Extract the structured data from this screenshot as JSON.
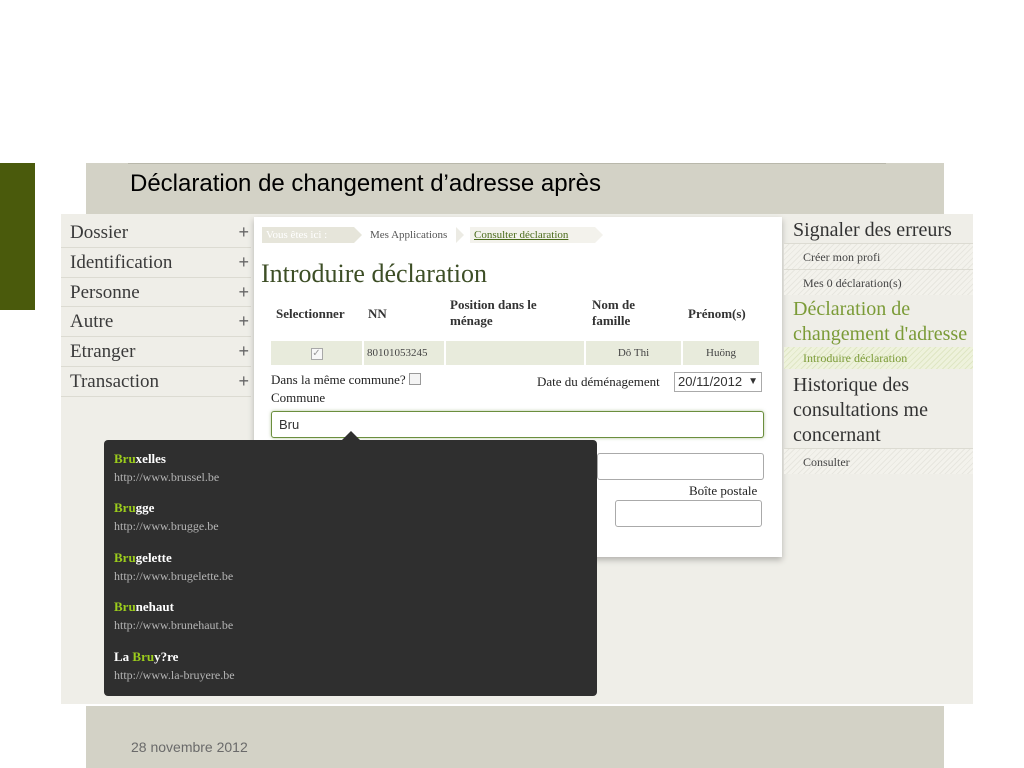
{
  "slide": {
    "title": "Déclaration de changement d’adresse après",
    "footer_date": "28 novembre 2012"
  },
  "left_nav": [
    {
      "label": "Dossier",
      "expander": "+"
    },
    {
      "label": "Identification",
      "expander": "+"
    },
    {
      "label": "Personne",
      "expander": "+"
    },
    {
      "label": "Autre",
      "expander": "+"
    },
    {
      "label": "Etranger",
      "expander": "+"
    },
    {
      "label": "Transaction",
      "expander": "+"
    }
  ],
  "breadcrumb": {
    "here": "Vous êtes ici :",
    "applications": "Mes Applications",
    "current": "Consulter déclaration"
  },
  "page_title": "Introduire déclaration",
  "table": {
    "headers": {
      "select": "Selectionner",
      "nn": "NN",
      "position": "Position dans le ménage",
      "nom": "Nom de famille",
      "prenom": "Prénom(s)"
    },
    "rows": [
      {
        "checked": true,
        "check_glyph": "✓",
        "nn": "80101053245",
        "position": "",
        "nom": "Dô Thi",
        "prenom": "Huöng"
      }
    ]
  },
  "form": {
    "same_commune_label": "Dans la même commune?",
    "move_date_label": "Date du déménagement",
    "move_date_value": "20/11/2012",
    "commune_label": "Commune",
    "commune_value": "Bru",
    "po_box_label": "Boîte postale"
  },
  "autocomplete": [
    {
      "prefix": "",
      "match": "Bru",
      "rest": "xelles",
      "url": "http://www.brussel.be"
    },
    {
      "prefix": "",
      "match": "Bru",
      "rest": "gge",
      "url": "http://www.brugge.be"
    },
    {
      "prefix": "",
      "match": "Bru",
      "rest": "gelette",
      "url": "http://www.brugelette.be"
    },
    {
      "prefix": "",
      "match": "Bru",
      "rest": "nehaut",
      "url": "http://www.brunehaut.be"
    },
    {
      "prefix": "La ",
      "match": "Bru",
      "rest": "y?re",
      "url": "http://www.la-bruyere.be"
    }
  ],
  "right_nav": {
    "report_errors": "Signaler des erreurs",
    "create_profile": "Créer mon profi",
    "my_declarations": "Mes 0 déclaration(s)",
    "change_address": "Déclaration de changement d'adresse",
    "introduce": "Introduire déclaration",
    "history": "Historique des consultations me concernant",
    "consult": "Consulter"
  },
  "colors": {
    "accent_dark_green": "#4a5a0c",
    "link_green": "#7b9b37",
    "highlight_green": "#9ccd1c",
    "popup_bg": "#2f2f2f",
    "band_gray": "#d3d2c6"
  }
}
